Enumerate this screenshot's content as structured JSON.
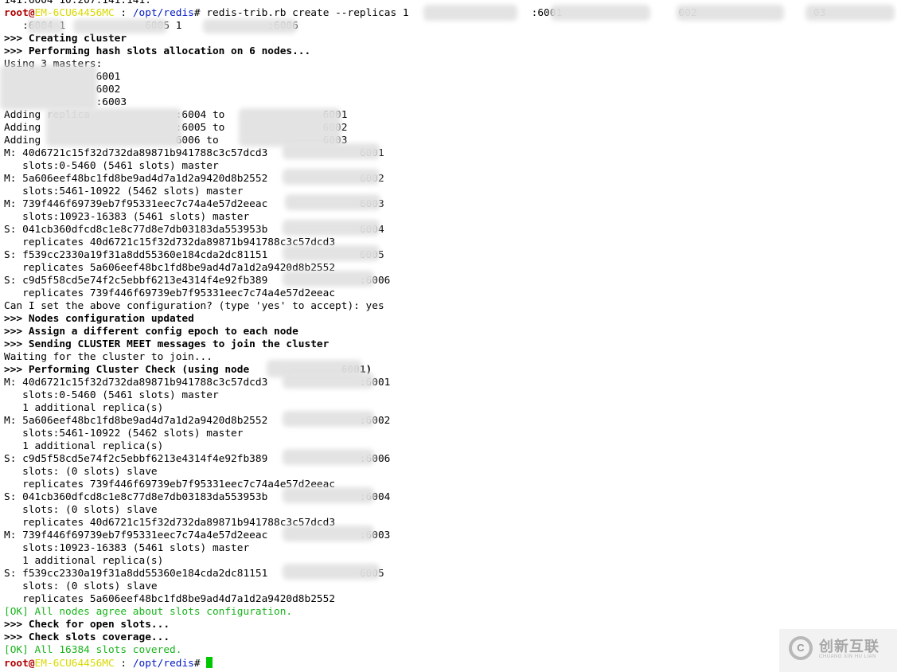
{
  "prompt": {
    "user": "root",
    "at": "@",
    "host": "EM-6CU64456MC",
    "sep": " : ",
    "path": "/opt/redis",
    "symbol": "# "
  },
  "lines": [
    {
      "text": "141:6004 10.207.141.141:",
      "style": "normal"
    },
    {
      "text": "redis-trib.rb create --replicas 1                    :6001                   002                   03",
      "style": "prompt"
    },
    {
      "text": "   :6004 1             6005 1              :6006",
      "style": "normal"
    },
    {
      "text": ">>> Creating cluster",
      "style": "bold"
    },
    {
      "text": ">>> Performing hash slots allocation on 6 nodes...",
      "style": "bold"
    },
    {
      "text": "Using 3 masters:",
      "style": "normal"
    },
    {
      "text": "               6001",
      "style": "normal"
    },
    {
      "text": "               6002",
      "style": "normal"
    },
    {
      "text": "               :6003",
      "style": "normal"
    },
    {
      "text": "Adding replica              :6004 to                6001",
      "style": "normal"
    },
    {
      "text": "Adding                      :6005 to                6002",
      "style": "normal"
    },
    {
      "text": "Adding                      6006 to                 6003",
      "style": "normal"
    },
    {
      "text": "M: 40d6721c15f32d732da89871b941788c3c57dcd3               6001",
      "style": "normal"
    },
    {
      "text": "   slots:0-5460 (5461 slots) master",
      "style": "normal"
    },
    {
      "text": "M: 5a606eef48bc1fd8be9ad4d7a1d2a9420d8b2552               6002",
      "style": "normal"
    },
    {
      "text": "   slots:5461-10922 (5462 slots) master",
      "style": "normal"
    },
    {
      "text": "M: 739f446f69739eb7f95331eec7c74a4e57d2eeac               6003",
      "style": "normal"
    },
    {
      "text": "   slots:10923-16383 (5461 slots) master",
      "style": "normal"
    },
    {
      "text": "S: 041cb360dfcd8c1e8c77d8e7db03183da553953b               6004",
      "style": "normal"
    },
    {
      "text": "   replicates 40d6721c15f32d732da89871b941788c3c57dcd3",
      "style": "normal"
    },
    {
      "text": "S: f539cc2330a19f31a8dd55360e184cda2dc81151               6005",
      "style": "normal"
    },
    {
      "text": "   replicates 5a606eef48bc1fd8be9ad4d7a1d2a9420d8b2552",
      "style": "normal"
    },
    {
      "text": "S: c9d5f58cd5e74f2c5ebbf6213e4314f4e92fb389               :6006",
      "style": "normal"
    },
    {
      "text": "   replicates 739f446f69739eb7f95331eec7c74a4e57d2eeac",
      "style": "normal"
    },
    {
      "text": "Can I set the above configuration? (type 'yes' to accept): yes",
      "style": "normal"
    },
    {
      "text": ">>> Nodes configuration updated",
      "style": "bold"
    },
    {
      "text": ">>> Assign a different config epoch to each node",
      "style": "bold"
    },
    {
      "text": ">>> Sending CLUSTER MEET messages to join the cluster",
      "style": "bold"
    },
    {
      "text": "Waiting for the cluster to join...",
      "style": "normal"
    },
    {
      "text": ">>> Performing Cluster Check (using node               6001)",
      "style": "bold"
    },
    {
      "text": "M: 40d6721c15f32d732da89871b941788c3c57dcd3               :6001",
      "style": "normal"
    },
    {
      "text": "   slots:0-5460 (5461 slots) master",
      "style": "normal"
    },
    {
      "text": "   1 additional replica(s)",
      "style": "normal"
    },
    {
      "text": "M: 5a606eef48bc1fd8be9ad4d7a1d2a9420d8b2552               :6002",
      "style": "normal"
    },
    {
      "text": "   slots:5461-10922 (5462 slots) master",
      "style": "normal"
    },
    {
      "text": "   1 additional replica(s)",
      "style": "normal"
    },
    {
      "text": "S: c9d5f58cd5e74f2c5ebbf6213e4314f4e92fb389               :6006",
      "style": "normal"
    },
    {
      "text": "   slots: (0 slots) slave",
      "style": "normal"
    },
    {
      "text": "   replicates 739f446f69739eb7f95331eec7c74a4e57d2eeac",
      "style": "normal"
    },
    {
      "text": "S: 041cb360dfcd8c1e8c77d8e7db03183da553953b               :6004",
      "style": "normal"
    },
    {
      "text": "   slots: (0 slots) slave",
      "style": "normal"
    },
    {
      "text": "   replicates 40d6721c15f32d732da89871b941788c3c57dcd3",
      "style": "normal"
    },
    {
      "text": "M: 739f446f69739eb7f95331eec7c74a4e57d2eeac               :6003",
      "style": "normal"
    },
    {
      "text": "   slots:10923-16383 (5461 slots) master",
      "style": "normal"
    },
    {
      "text": "   1 additional replica(s)",
      "style": "normal"
    },
    {
      "text": "S: f539cc2330a19f31a8dd55360e184cda2dc81151               6005",
      "style": "normal"
    },
    {
      "text": "   slots: (0 slots) slave",
      "style": "normal"
    },
    {
      "text": "   replicates 5a606eef48bc1fd8be9ad4d7a1d2a9420d8b2552",
      "style": "normal"
    },
    {
      "text": "[OK] All nodes agree about slots configuration.",
      "style": "ok"
    },
    {
      "text": ">>> Check for open slots...",
      "style": "bold"
    },
    {
      "text": ">>> Check slots coverage...",
      "style": "bold"
    },
    {
      "text": "[OK] All 16384 slots covered.",
      "style": "ok"
    },
    {
      "text": "",
      "style": "prompt-cursor"
    }
  ],
  "watermark": {
    "logo": "创新互联",
    "sub": "CHUANG XIN HU LIAN"
  },
  "colors": {
    "background": "#ffffff",
    "text": "#000000",
    "ok": "#19b41c",
    "cursor": "#00c800"
  }
}
